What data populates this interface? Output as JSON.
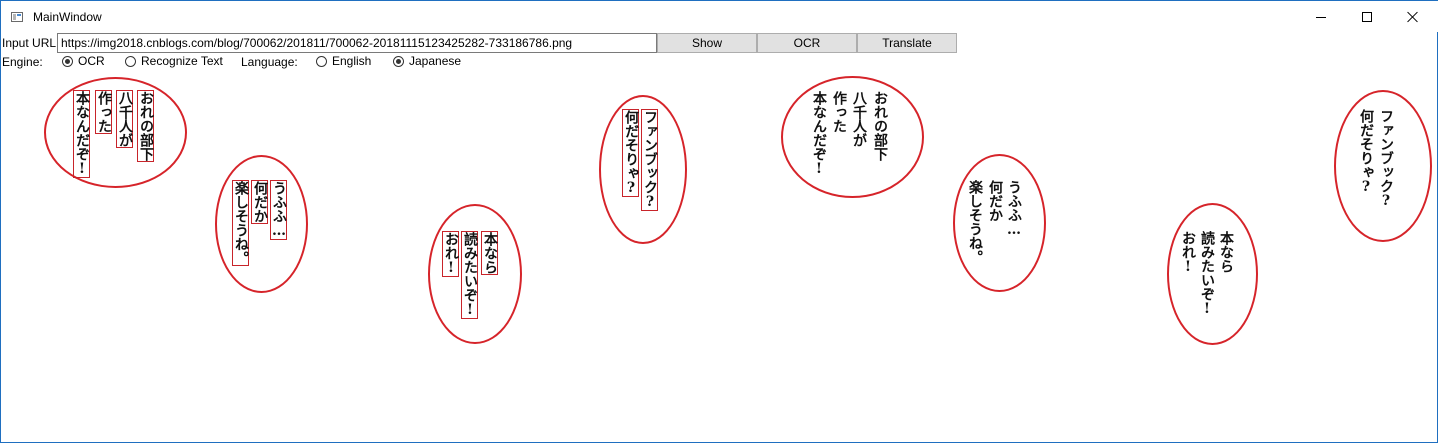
{
  "window": {
    "title": "MainWindow"
  },
  "toolbar": {
    "url_label": "Input URL:",
    "url_value": "https://img2018.cnblogs.com/blog/700062/201811/700062-20181115123425282-733186786.png",
    "show_label": "Show",
    "ocr_label": "OCR",
    "translate_label": "Translate"
  },
  "options": {
    "engine_label": "Engine:",
    "engine_ocr": "OCR",
    "engine_recognize": "Recognize Text",
    "engine_selected": "OCR",
    "language_label": "Language:",
    "lang_english": "English",
    "lang_japanese": "Japanese",
    "language_selected": "Japanese"
  },
  "detected": {
    "b1": [
      "おれの部下",
      "八千人が",
      "作った",
      "本なんだぞ!"
    ],
    "b2": [
      "うふふ…",
      "何だか",
      "楽しそうね。"
    ],
    "b3": [
      "本なら",
      "読みたいぞ!",
      "おれ!"
    ],
    "b4": [
      "ファンブック?",
      "何だそりゃ?"
    ]
  },
  "original": {
    "b1": [
      "おれの部下",
      "八千人が",
      "作った",
      "本なんだぞ!"
    ],
    "b2": [
      "うふふ…",
      "何だか",
      "楽しそうね。"
    ],
    "b3": [
      "本なら",
      "読みたいぞ!",
      "おれ!"
    ],
    "b4": [
      "ファンブック?",
      "何だそりゃ?"
    ]
  },
  "colors": {
    "bubble_outline": "#d6242a",
    "ocr_box": "#c8242a",
    "window_border": "#1f6fc0"
  }
}
